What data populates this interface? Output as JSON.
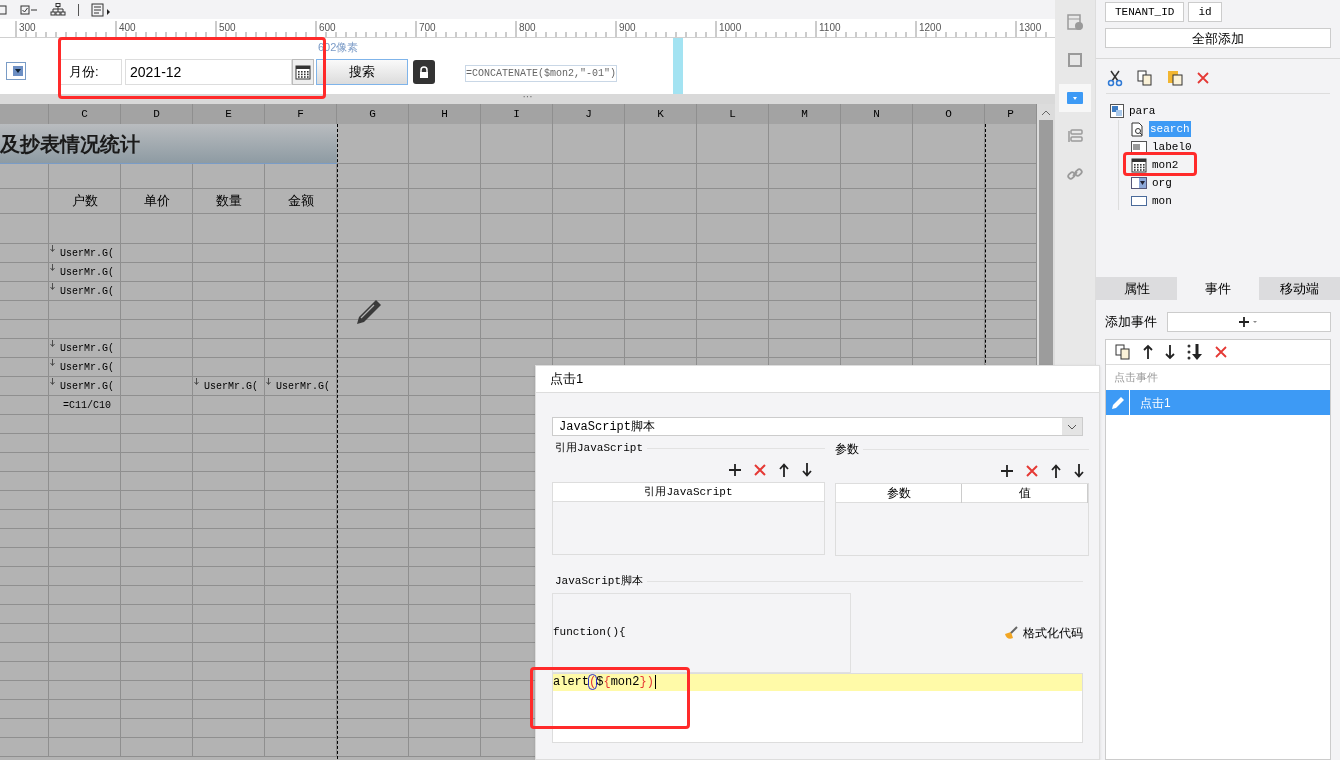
{
  "ruler": {
    "ticks": [
      "300",
      "400",
      "500",
      "600",
      "700",
      "800",
      "900",
      "1000",
      "1100",
      "1200",
      "1300"
    ]
  },
  "params": {
    "label": "月份:",
    "value": "2021-12",
    "button": "搜索",
    "width_hint": "602像素",
    "formula": "=CONCATENATE($mon2,\"-01\")",
    "handle": "···"
  },
  "sheet": {
    "columns": [
      "C",
      "D",
      "E",
      "F",
      "G",
      "H",
      "I",
      "J",
      "K",
      "L",
      "M",
      "N",
      "O",
      "P"
    ],
    "title": "及抄表情况统计",
    "rows": [
      {
        "kind": "title"
      },
      {
        "kind": "blank"
      },
      {
        "kind": "header",
        "cells": {
          "C": {
            "text": "户数"
          },
          "D": {
            "text": "单价"
          },
          "E": {
            "text": "数量"
          },
          "F": {
            "text": "金额"
          }
        }
      },
      {
        "kind": "tall"
      },
      {
        "kind": "data",
        "cells": {
          "C": {
            "text": "UserMr.G(",
            "kind": "expand"
          }
        }
      },
      {
        "kind": "data",
        "cells": {
          "C": {
            "text": "UserMr.G(",
            "kind": "expand"
          }
        }
      },
      {
        "kind": "data",
        "cells": {
          "C": {
            "text": "UserMr.G(",
            "kind": "expand"
          }
        }
      },
      {
        "kind": "data"
      },
      {
        "kind": "data"
      },
      {
        "kind": "data",
        "cells": {
          "C": {
            "text": "UserMr.G(",
            "kind": "expand"
          }
        }
      },
      {
        "kind": "data",
        "cells": {
          "C": {
            "text": "UserMr.G(",
            "kind": "expand"
          }
        }
      },
      {
        "kind": "data",
        "cells": {
          "C": {
            "text": "UserMr.G(",
            "kind": "expand"
          },
          "E": {
            "text": "UserMr.G(",
            "kind": "expand"
          },
          "F": {
            "text": "UserMr.G(",
            "kind": "expand"
          }
        }
      },
      {
        "kind": "data",
        "cells": {
          "C": {
            "text": "=C11/C10",
            "kind": "formula"
          }
        }
      }
    ]
  },
  "side_tools": [
    {
      "kind": "info",
      "selected": false
    },
    {
      "kind": "frame",
      "selected": false
    },
    {
      "kind": "combo",
      "selected": true
    },
    {
      "kind": "layout",
      "selected": false
    },
    {
      "kind": "link",
      "selected": false
    }
  ],
  "fields": {
    "chips": [
      "TENANT_ID",
      "id"
    ],
    "add_all": "全部添加"
  },
  "tree": {
    "label": "para",
    "children": [
      {
        "label": "search",
        "kind": "search",
        "selected": true
      },
      {
        "label": "label0",
        "kind": "label",
        "selected": false
      },
      {
        "label": "mon2",
        "kind": "date",
        "selected": false
      },
      {
        "label": "org",
        "kind": "combo",
        "selected": false
      },
      {
        "label": "mon",
        "kind": "text",
        "selected": false
      }
    ]
  },
  "tabs": [
    {
      "label": "属性",
      "selected": false
    },
    {
      "label": "事件",
      "selected": true
    },
    {
      "label": "移动端",
      "selected": false
    }
  ],
  "events": {
    "add_label": "添加事件",
    "group": "点击事件",
    "items": [
      {
        "label": "点击1",
        "selected": true
      }
    ]
  },
  "dialog": {
    "title": "点击1",
    "type": "JavaScript脚本",
    "ref_group": "引用JavaScript",
    "ref_columns": [
      "引用JavaScript"
    ],
    "param_group": "参数",
    "param_columns": [
      "参数",
      "值"
    ],
    "script_group": "JavaScript脚本",
    "prelude": "function(){",
    "format_button": "格式化代码",
    "code": [
      {
        "text": "alert",
        "kind": "plain"
      },
      {
        "text": "(",
        "kind": "match"
      },
      {
        "text": "$",
        "kind": "plain"
      },
      {
        "text": "{",
        "kind": "bracket"
      },
      {
        "text": "mon2",
        "kind": "plain"
      },
      {
        "text": "}",
        "kind": "bracket"
      },
      {
        "text": ")",
        "kind": "bracket"
      }
    ]
  }
}
